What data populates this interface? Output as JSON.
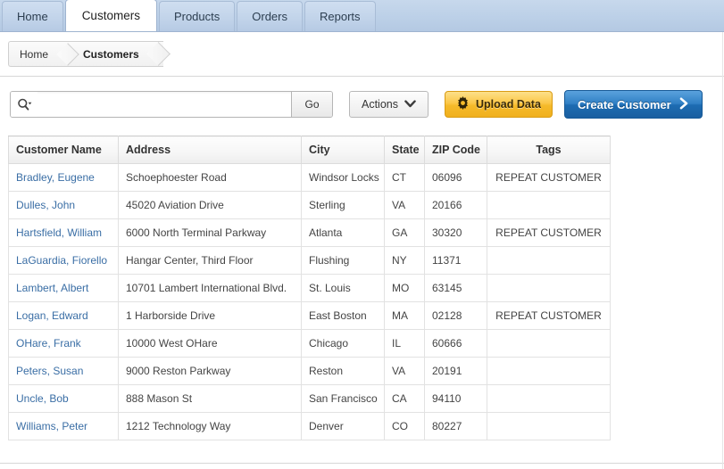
{
  "tabs": [
    {
      "label": "Home",
      "active": false
    },
    {
      "label": "Customers",
      "active": true
    },
    {
      "label": "Products",
      "active": false
    },
    {
      "label": "Orders",
      "active": false
    },
    {
      "label": "Reports",
      "active": false
    }
  ],
  "breadcrumb": {
    "items": [
      "Home",
      "Customers"
    ]
  },
  "toolbar": {
    "search_value": "",
    "search_placeholder": "",
    "search_icon": "search-magnifier-dropdown-icon",
    "go_label": "Go",
    "actions_label": "Actions",
    "actions_icon": "chevron-down-icon",
    "upload_label": "Upload Data",
    "upload_icon": "gear-icon",
    "create_label": "Create Customer",
    "create_icon": "chevron-right-icon"
  },
  "colors": {
    "tabbar": "#bdd1e8",
    "link": "#3a6ea5",
    "upload_button": "#fbc748",
    "create_button": "#2f7fc4"
  },
  "table": {
    "columns": [
      "Customer Name",
      "Address",
      "City",
      "State",
      "ZIP Code",
      "Tags"
    ],
    "rows": [
      {
        "name": "Bradley, Eugene",
        "address": "Schoephoester Road",
        "city": "Windsor Locks",
        "state": "CT",
        "zip": "06096",
        "tags": "REPEAT CUSTOMER"
      },
      {
        "name": "Dulles, John",
        "address": "45020 Aviation Drive",
        "city": "Sterling",
        "state": "VA",
        "zip": "20166",
        "tags": ""
      },
      {
        "name": "Hartsfield, William",
        "address": "6000 North Terminal Parkway",
        "city": "Atlanta",
        "state": "GA",
        "zip": "30320",
        "tags": "REPEAT CUSTOMER"
      },
      {
        "name": "LaGuardia, Fiorello",
        "address": "Hangar Center, Third Floor",
        "city": "Flushing",
        "state": "NY",
        "zip": "11371",
        "tags": ""
      },
      {
        "name": "Lambert, Albert",
        "address": "10701 Lambert International Blvd.",
        "city": "St. Louis",
        "state": "MO",
        "zip": "63145",
        "tags": ""
      },
      {
        "name": "Logan, Edward",
        "address": "1 Harborside Drive",
        "city": "East Boston",
        "state": "MA",
        "zip": "02128",
        "tags": "REPEAT CUSTOMER"
      },
      {
        "name": "OHare, Frank",
        "address": "10000 West OHare",
        "city": "Chicago",
        "state": "IL",
        "zip": "60666",
        "tags": ""
      },
      {
        "name": "Peters, Susan",
        "address": "9000 Reston Parkway",
        "city": "Reston",
        "state": "VA",
        "zip": "20191",
        "tags": ""
      },
      {
        "name": "Uncle, Bob",
        "address": "888 Mason St",
        "city": "San Francisco",
        "state": "CA",
        "zip": "94110",
        "tags": ""
      },
      {
        "name": "Williams, Peter",
        "address": "1212 Technology Way",
        "city": "Denver",
        "state": "CO",
        "zip": "80227",
        "tags": ""
      }
    ]
  }
}
